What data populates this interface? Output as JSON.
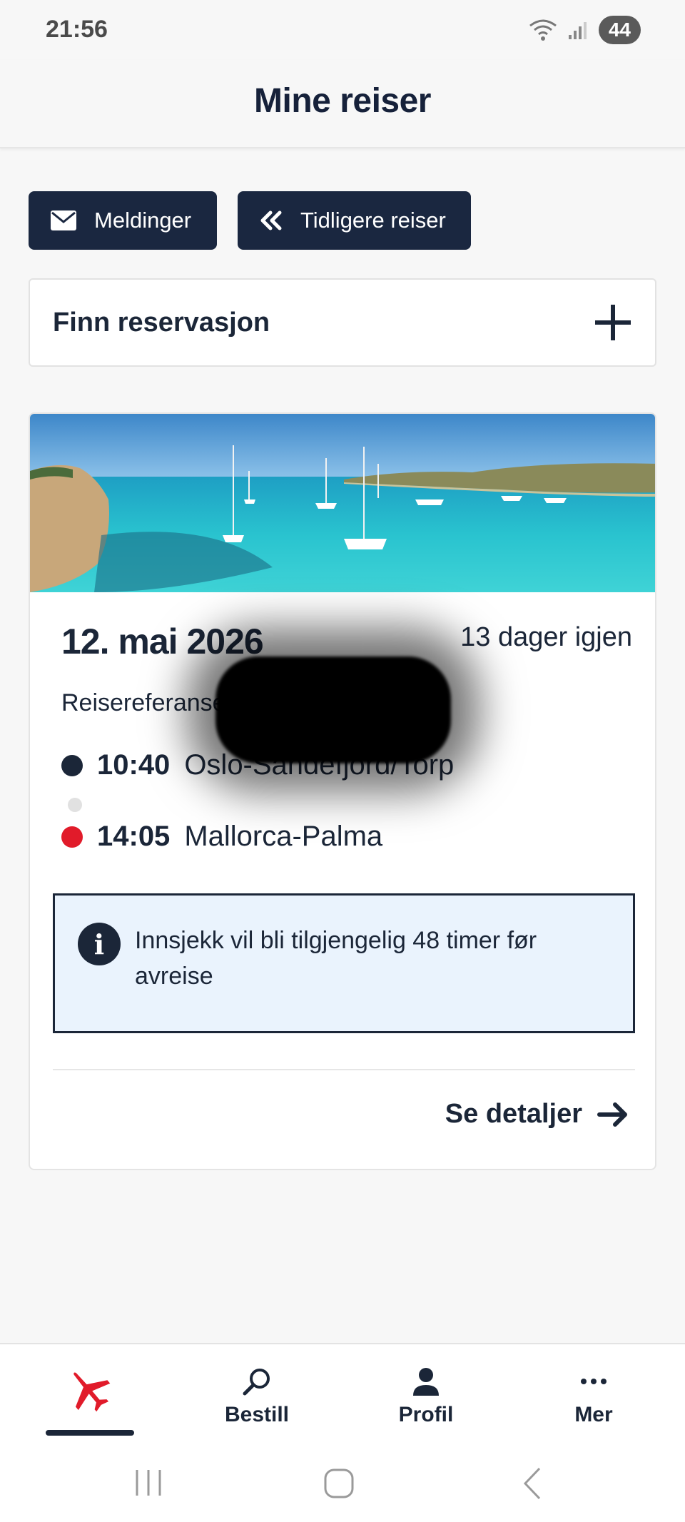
{
  "status_bar": {
    "time": "21:56",
    "battery": "44"
  },
  "header": {
    "title": "Mine reiser"
  },
  "actions": {
    "messages_label": "Meldinger",
    "previous_trips_label": "Tidligere reiser"
  },
  "find_reservation": {
    "label": "Finn reservasjon"
  },
  "trip": {
    "date": "12. mai 2026",
    "countdown": "13 dager igjen",
    "reference_label": "Reisereferanse",
    "departure": {
      "time": "10:40",
      "airport": "Oslo-Sandefjord/Torp"
    },
    "arrival": {
      "time": "14:05",
      "airport": "Mallorca-Palma"
    },
    "info": "Innsjekk vil bli tilgjengelig 48 timer før avreise",
    "details_label": "Se detaljer"
  },
  "bottom_nav": {
    "items": [
      {
        "label": "",
        "icon": "plane-icon",
        "active": true
      },
      {
        "label": "Bestill",
        "icon": "search-icon"
      },
      {
        "label": "Profil",
        "icon": "person-icon"
      },
      {
        "label": "Mer",
        "icon": "more-icon"
      }
    ]
  },
  "colors": {
    "primary": "#1b2638",
    "accent_red": "#e11b2a",
    "info_bg": "#eaf3fd"
  }
}
